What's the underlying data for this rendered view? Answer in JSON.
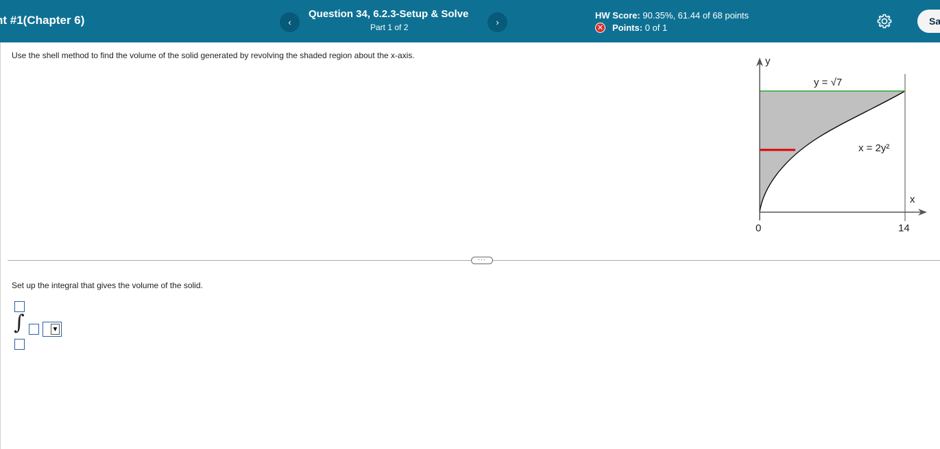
{
  "header": {
    "assignment_title": "nt #1(Chapter 6)",
    "prev_label": "‹",
    "next_label": "›",
    "question_title": "Question 34, 6.2.3-Setup & Solve",
    "question_part": "Part 1 of 2",
    "hw_score_label": "HW Score:",
    "hw_score_value": "90.35%, 61.44 of 68 points",
    "points_label": "Points:",
    "points_value": "0 of 1",
    "save_label": "Sa"
  },
  "question": {
    "text": "Use the shell method to find the volume of the solid generated by revolving the shaded region about the x-axis.",
    "instruction": "Set up the integral that gives the volume of the solid."
  },
  "graph": {
    "y_axis_label": "y",
    "x_axis_label": "x",
    "origin_label": "0",
    "x_tick_label": "14",
    "top_line_label": "y = √7",
    "curve_label": "x = 2y²",
    "x_max": 14,
    "y_max": 2.6458
  },
  "divider": {
    "expand_label": "···"
  },
  "answer": {
    "integral_symbol": "∫",
    "dropdown_arrow": "▼"
  },
  "colors": {
    "header_bg": "#0e7193",
    "shade": "#c0c0c0",
    "top_line": "#2aa52a",
    "strip": "#e00000"
  }
}
